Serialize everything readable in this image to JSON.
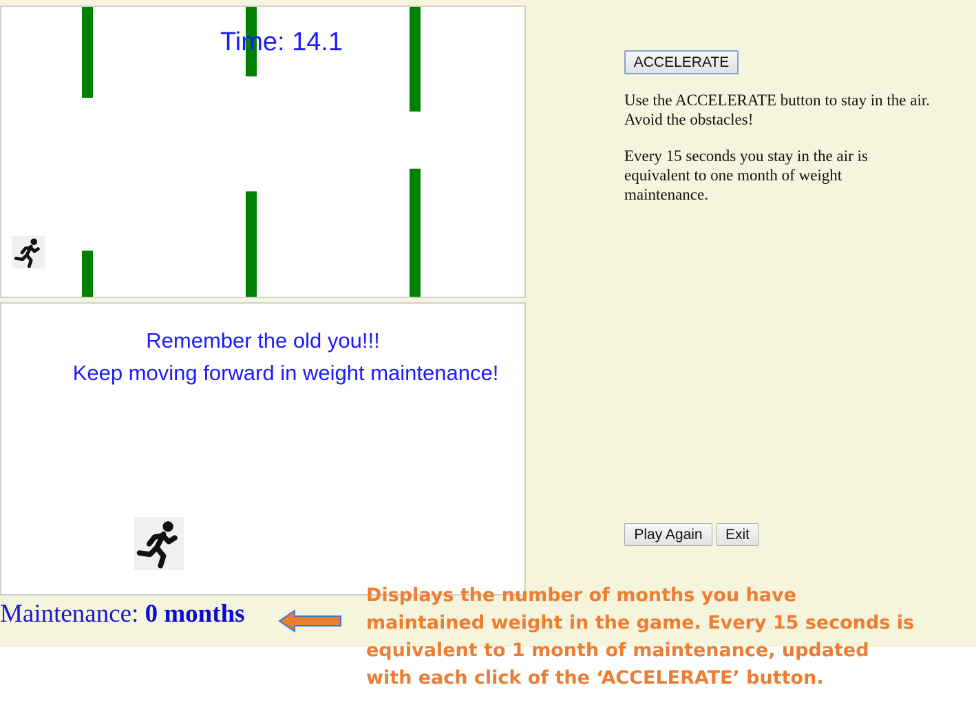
{
  "game": {
    "timer_label": "Time:",
    "timer_value": "14.1"
  },
  "message": {
    "line1": "Remember the old you!!!",
    "line2": "Keep moving forward in weight maintenance!"
  },
  "controls": {
    "accelerate_label": "ACCELERATE",
    "play_again_label": "Play Again",
    "exit_label": "Exit"
  },
  "instructions": {
    "p1": "Use the ACCELERATE button to stay in the air. Avoid the obstacles!",
    "p2": "Every 15 seconds you stay in the air is equivalent to one month of weight maintenance."
  },
  "maintenance": {
    "label": "Maintenance:",
    "value": "0 months"
  },
  "annotation": {
    "text": "Displays the number of months you have maintained weight in the game.  Every 15 seconds is equivalent to 1 month of maintenance, updated with each click of the ‘ACCELERATE’ button.",
    "color": "#ed7d31"
  },
  "colors": {
    "background": "#f5f4dc",
    "obstacle": "#008000",
    "timer_text": "#1a1aff",
    "maintenance_text": "#1a1acc"
  },
  "icons": {
    "player": "runner-icon",
    "runner_large": "runner-icon",
    "arrow": "left-arrow-icon"
  }
}
